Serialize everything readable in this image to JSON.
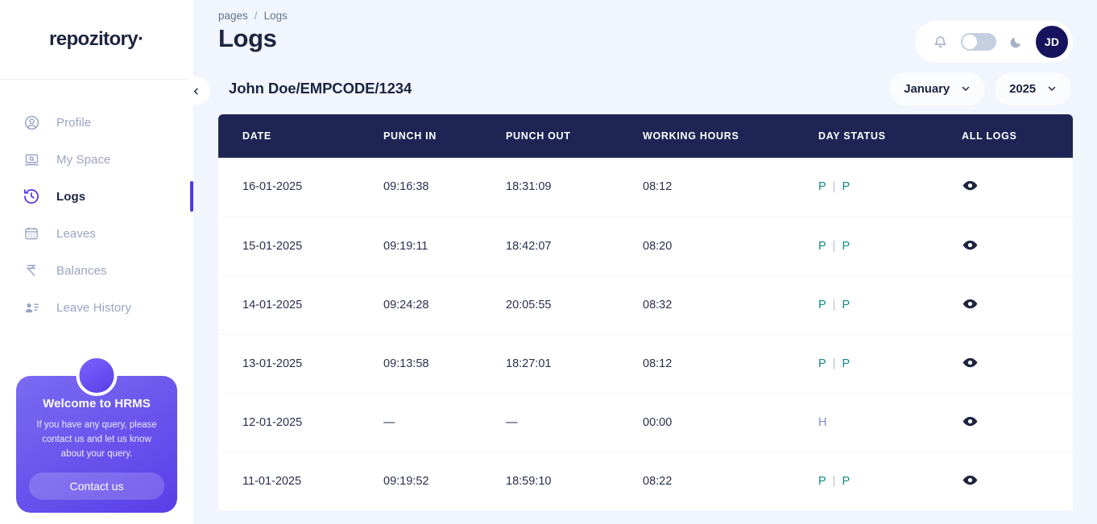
{
  "brand": {
    "name": "repozitory",
    "dot": "·"
  },
  "sidebar": {
    "collapse_icon": "chevron-left-icon",
    "items": [
      {
        "label": "Profile",
        "icon": "user-circle-icon",
        "active": false
      },
      {
        "label": "My Space",
        "icon": "laptop-search-icon",
        "active": false
      },
      {
        "label": "Logs",
        "icon": "clock-rewind-icon",
        "active": true
      },
      {
        "label": "Leaves",
        "icon": "calendar-icon",
        "active": false
      },
      {
        "label": "Balances",
        "icon": "rupee-icon",
        "active": false
      },
      {
        "label": "Leave History",
        "icon": "user-list-icon",
        "active": false
      }
    ],
    "promo": {
      "title": "Welcome to HRMS",
      "body": "If you have any query, please contact us and let us know about your query.",
      "button": "Contact us"
    }
  },
  "header": {
    "breadcrumb": {
      "parent": "pages",
      "separator": "/",
      "current": "Logs"
    },
    "title": "Logs",
    "actions": {
      "bell_icon": "bell-icon",
      "theme_toggle_state": "off",
      "moon_icon": "moon-icon",
      "avatar_initials": "JD"
    }
  },
  "subheader": {
    "employee": "John Doe/EMPCODE/1234",
    "month_filter": "January",
    "year_filter": "2025",
    "chevron_icon": "chevron-down-icon"
  },
  "table": {
    "columns": [
      "DATE",
      "PUNCH IN",
      "PUNCH OUT",
      "WORKING HOURS",
      "DAY STATUS",
      "ALL LOGS"
    ],
    "rows": [
      {
        "date": "16-01-2025",
        "punch_in": "09:16:38",
        "punch_out": "18:31:09",
        "working_hours": "08:12",
        "status": [
          "P",
          "P"
        ],
        "status_sep": "|",
        "action_icon": "eye-icon"
      },
      {
        "date": "15-01-2025",
        "punch_in": "09:19:11",
        "punch_out": "18:42:07",
        "working_hours": "08:20",
        "status": [
          "P",
          "P"
        ],
        "status_sep": "|",
        "action_icon": "eye-icon"
      },
      {
        "date": "14-01-2025",
        "punch_in": "09:24:28",
        "punch_out": "20:05:55",
        "working_hours": "08:32",
        "status": [
          "P",
          "P"
        ],
        "status_sep": "|",
        "action_icon": "eye-icon"
      },
      {
        "date": "13-01-2025",
        "punch_in": "09:13:58",
        "punch_out": "18:27:01",
        "working_hours": "08:12",
        "status": [
          "P",
          "P"
        ],
        "status_sep": "|",
        "action_icon": "eye-icon"
      },
      {
        "date": "12-01-2025",
        "punch_in": "—",
        "punch_out": "—",
        "working_hours": "00:00",
        "status": [
          "H"
        ],
        "status_sep": "",
        "action_icon": "eye-icon"
      },
      {
        "date": "11-01-2025",
        "punch_in": "09:19:52",
        "punch_out": "18:59:10",
        "working_hours": "08:22",
        "status": [
          "P",
          "P"
        ],
        "status_sep": "|",
        "action_icon": "eye-icon"
      }
    ]
  },
  "colors": {
    "accent": "#4f36ef",
    "header_navy": "#1e2555",
    "present": "#108a86",
    "holiday": "#7f8bc4",
    "page_bg": "#f1f5fd",
    "avatar_bg": "#17135c"
  }
}
